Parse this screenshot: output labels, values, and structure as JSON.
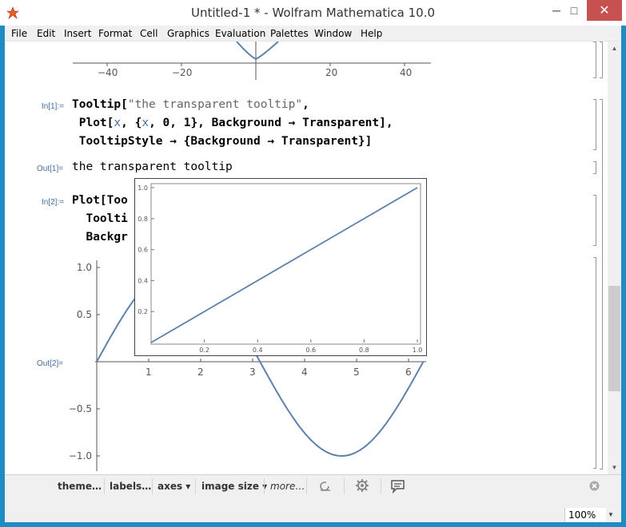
{
  "window": {
    "title": "Untitled-1 * - Wolfram Mathematica 10.0",
    "controls": {
      "minimize": "─",
      "maximize": "□",
      "close": "✕"
    }
  },
  "menu": [
    "File",
    "Edit",
    "Insert",
    "Format",
    "Cell",
    "Graphics",
    "Evaluation",
    "Palettes",
    "Window",
    "Help"
  ],
  "top_axis": {
    "ticks": [
      "−40",
      "−20",
      "20",
      "40"
    ]
  },
  "cell1": {
    "label": "In[1]:=",
    "line1_a": "Tooltip[",
    "line1_str": "\"the transparent tooltip\"",
    "line1_b": ",",
    "line2_a": " Plot[",
    "line2_x1": "x",
    "line2_b": ", {",
    "line2_x2": "x",
    "line2_c": ", 0, 1}, Background → Transparent],",
    "line3": " TooltipStyle → {Background → Transparent}]"
  },
  "out1": {
    "label": "Out[1]=",
    "text": "the transparent tooltip"
  },
  "cell2": {
    "label": "In[2]:=",
    "line1": "Plot[Too",
    "line2": "  Toolti",
    "line3": "  Backgr"
  },
  "out2": {
    "label": "Out[2]="
  },
  "chart_data": [
    {
      "type": "line",
      "series": [
        {
          "function": "sin(x)",
          "x": [
            0,
            0.79,
            1.57,
            2.36,
            3.14,
            3.93,
            4.71,
            5.5,
            6.28
          ],
          "y": [
            0,
            0.71,
            1.0,
            0.71,
            0,
            -0.71,
            -1.0,
            -0.71,
            0
          ]
        }
      ],
      "xticks": [
        "1",
        "2",
        "3",
        "4",
        "5",
        "6"
      ],
      "yticks": [
        "1.0",
        "0.5",
        "−0.5",
        "−1.0"
      ],
      "xlim": [
        0,
        6.28
      ],
      "ylim": [
        -1,
        1
      ]
    },
    {
      "type": "line",
      "series": [
        {
          "function": "x",
          "x": [
            0,
            1
          ],
          "y": [
            0,
            1
          ]
        }
      ],
      "xticks": [
        "0.2",
        "0.4",
        "0.6",
        "0.8",
        "1.0"
      ],
      "yticks": [
        "0.2",
        "0.4",
        "0.6",
        "0.8",
        "1.0"
      ],
      "xlim": [
        0,
        1
      ],
      "ylim": [
        0,
        1
      ]
    }
  ],
  "suggestions": [
    "theme…",
    "labels…",
    "axes ▾",
    "image size ▾",
    "more…"
  ],
  "status": {
    "zoom": "100%"
  },
  "colors": {
    "accent": "#1e8bc3",
    "curve": "#5e81ac",
    "close": "#c75050"
  }
}
